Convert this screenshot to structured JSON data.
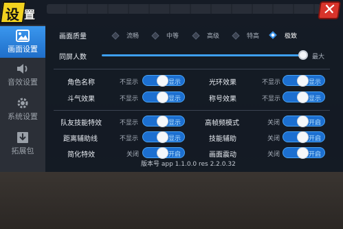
{
  "title": {
    "char1": "设",
    "char2": "置"
  },
  "close_label": "✕",
  "sidebar": {
    "items": [
      {
        "label": "画面设置",
        "icon": "image-icon",
        "active": true
      },
      {
        "label": "音效设置",
        "icon": "speaker-icon",
        "active": false
      },
      {
        "label": "系统设置",
        "icon": "gear-icon",
        "active": false
      },
      {
        "label": "拓展包",
        "icon": "download-icon",
        "active": false
      }
    ]
  },
  "quality": {
    "label": "画面质量",
    "options": [
      "流畅",
      "中等",
      "高级",
      "特高",
      "极致"
    ],
    "selected": "极致"
  },
  "players": {
    "label": "同屏人数",
    "max_label": "最大",
    "value_percent": 100
  },
  "rows": [
    {
      "left": {
        "label": "角色名称",
        "off": "不显示",
        "on": "显示"
      },
      "right": {
        "label": "光环效果",
        "off": "不显示",
        "on": "显示"
      }
    },
    {
      "left": {
        "label": "斗气效果",
        "off": "不显示",
        "on": "显示"
      },
      "right": {
        "label": "称号效果",
        "off": "不显示",
        "on": "显示"
      }
    },
    {
      "left": {
        "label": "队友技能特效",
        "off": "不显示",
        "on": "显示"
      },
      "right": {
        "label": "高帧频模式",
        "off": "关闭",
        "on": "开启"
      }
    },
    {
      "left": {
        "label": "距离辅助线",
        "off": "不显示",
        "on": "显示"
      },
      "right": {
        "label": "技能辅助",
        "off": "关闭",
        "on": "开启"
      }
    },
    {
      "left": {
        "label": "简化特效",
        "off": "关闭",
        "on": "开启"
      },
      "right": {
        "label": "画面震动",
        "off": "关闭",
        "on": "开启"
      }
    }
  ],
  "version": "版本号  app  1.1.0.0   res  2.2.0.32",
  "colors": {
    "accent": "#2f8de8",
    "close": "#d8342b",
    "title": "#f2d21f"
  }
}
